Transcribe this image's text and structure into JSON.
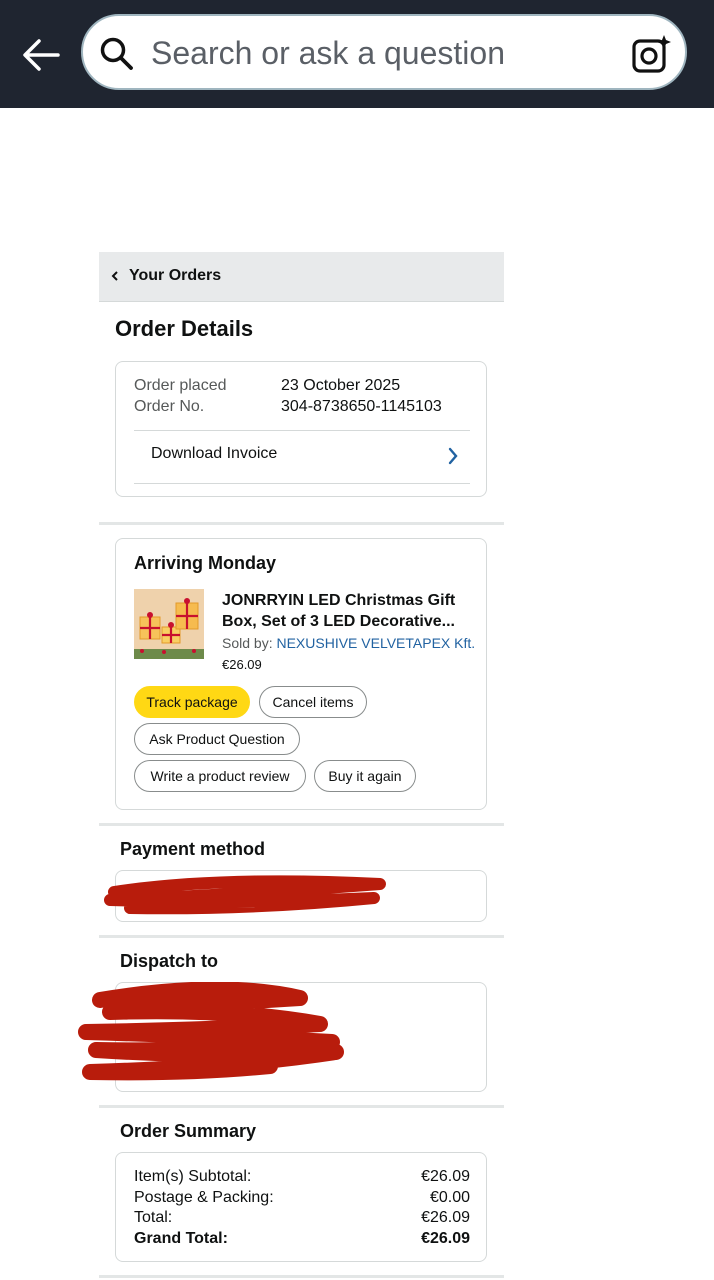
{
  "search": {
    "placeholder": "Search or ask a question"
  },
  "breadcrumb": {
    "label": "Your Orders"
  },
  "page_title": "Order Details",
  "order_info": {
    "placed_label": "Order placed",
    "placed_value": "23 October 2025",
    "number_label": "Order No.",
    "number_value": "304-8738650-1145103",
    "download_invoice": "Download Invoice"
  },
  "shipment": {
    "status": "Arriving Monday",
    "product_title": "JONRRYIN LED Christmas Gift Box, Set of 3 LED Decorative...",
    "sold_by_label": "Sold by:",
    "seller": "NEXUSHIVE VELVETAPEX Kft.",
    "price": "€26.09",
    "actions": {
      "track": "Track package",
      "cancel": "Cancel items",
      "ask": "Ask Product Question",
      "review": "Write a product review",
      "buy_again": "Buy it again"
    }
  },
  "payment": {
    "title": "Payment method"
  },
  "dispatch": {
    "title": "Dispatch to"
  },
  "summary": {
    "title": "Order Summary",
    "rows": [
      {
        "label": "Item(s) Subtotal:",
        "value": "€26.09"
      },
      {
        "label": "Postage & Packing:",
        "value": "€0.00"
      },
      {
        "label": "Total:",
        "value": "€26.09"
      },
      {
        "label": "Grand Total:",
        "value": "€26.09"
      }
    ]
  },
  "colors": {
    "topbar": "#1f2530",
    "track_button": "#ffd814",
    "link": "#2162a1",
    "redaction": "#b81c0c"
  }
}
